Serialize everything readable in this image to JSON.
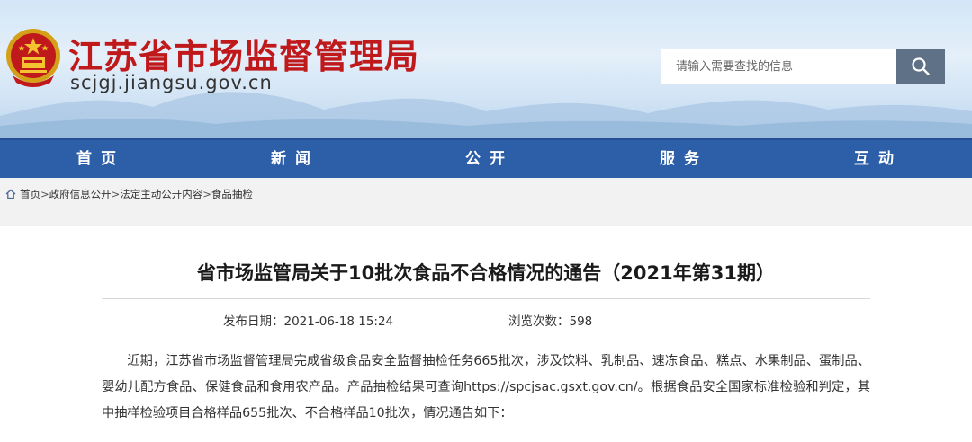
{
  "header": {
    "site_title": "江苏省市场监督管理局",
    "site_domain": "scjgj.jiangsu.gov.cn",
    "emblem_icon": "national-emblem-icon"
  },
  "search": {
    "placeholder": "请输入需要查找的信息",
    "button_icon": "search-icon"
  },
  "nav": {
    "items": [
      {
        "label": "首 页"
      },
      {
        "label": "新 闻"
      },
      {
        "label": "公 开"
      },
      {
        "label": "服 务"
      },
      {
        "label": "互 动"
      }
    ]
  },
  "breadcrumb": {
    "items": [
      "首页",
      "政府信息公开",
      "法定主动公开内容",
      "食品抽检"
    ],
    "separator": ">"
  },
  "article": {
    "title": "省市场监管局关于10批次食品不合格情况的通告（2021年第31期）",
    "date_label": "发布日期：2021-06-18 15:24",
    "views_label": "浏览次数：598",
    "body": "近期，江苏省市场监督管理局完成省级食品安全监督抽检任务665批次，涉及饮料、乳制品、速冻食品、糕点、水果制品、蛋制品、婴幼儿配方食品、保健食品和食用农产品。产品抽检结果可查询https://spcjsac.gsxt.gov.cn/。根据食品安全国家标准检验和判定，其中抽样检验项目合格样品655批次、不合格样品10批次，情况通告如下："
  },
  "colors": {
    "brand_red": "#c0191c",
    "nav_blue": "#2d5ea8",
    "search_button": "#5f7186"
  }
}
